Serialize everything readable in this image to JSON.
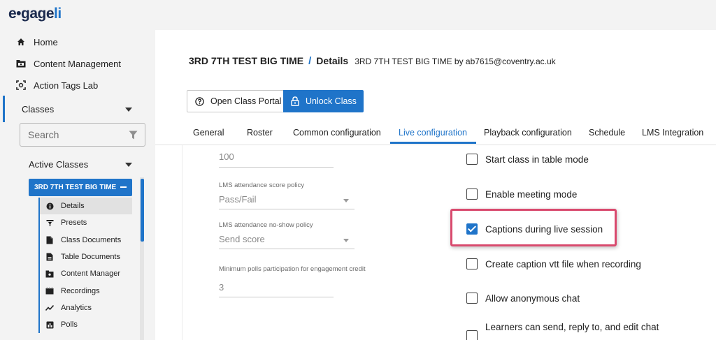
{
  "app": {
    "logo_text_main": "e•gage",
    "logo_text_accent": "li"
  },
  "sidebar": {
    "nav": [
      {
        "label": "Home",
        "icon": "home-icon"
      },
      {
        "label": "Content Management",
        "icon": "folder-icon"
      },
      {
        "label": "Action Tags Lab",
        "icon": "scan-icon"
      }
    ],
    "classes_label": "Classes",
    "search_placeholder": "Search",
    "active_classes_label": "Active Classes",
    "selected_class": "3RD 7TH TEST BIG TIME",
    "sub_items": [
      {
        "label": "Details",
        "icon": "info-icon",
        "active": true
      },
      {
        "label": "Presets",
        "icon": "presets-icon",
        "active": false
      },
      {
        "label": "Class Documents",
        "icon": "document-icon",
        "active": false
      },
      {
        "label": "Table Documents",
        "icon": "table-document-icon",
        "active": false
      },
      {
        "label": "Content Manager",
        "icon": "folder-icon",
        "active": false
      },
      {
        "label": "Recordings",
        "icon": "recordings-icon",
        "active": false
      },
      {
        "label": "Analytics",
        "icon": "analytics-icon",
        "active": false
      },
      {
        "label": "Polls",
        "icon": "polls-icon",
        "active": false
      }
    ]
  },
  "header": {
    "class_name": "3RD 7TH TEST BIG TIME",
    "separator": "/",
    "page_title": "Details",
    "owner_text": "3RD 7TH TEST BIG TIME by ab7615@coventry.ac.uk"
  },
  "actions": {
    "open_portal_label": "Open Class Portal",
    "unlock_label": "Unlock Class"
  },
  "tabs": [
    {
      "label": "General",
      "active": false
    },
    {
      "label": "Roster",
      "active": false
    },
    {
      "label": "Common configuration",
      "active": false
    },
    {
      "label": "Live configuration",
      "active": true
    },
    {
      "label": "Playback configuration",
      "active": false
    },
    {
      "label": "Schedule",
      "active": false
    },
    {
      "label": "LMS Integration",
      "active": false
    }
  ],
  "fields": {
    "top_value": "100",
    "attendance_policy": {
      "label": "LMS attendance score policy",
      "value": "Pass/Fail"
    },
    "no_show_policy": {
      "label": "LMS attendance no-show policy",
      "value": "Send score"
    },
    "min_polls": {
      "label": "Minimum polls participation for engagement credit",
      "value": "3"
    }
  },
  "checkboxes": [
    {
      "label": "Start class in table mode",
      "checked": false
    },
    {
      "label": "Enable meeting mode",
      "checked": false
    },
    {
      "label": "Captions during live session",
      "checked": true
    },
    {
      "label": "Create caption vtt file when recording",
      "checked": false
    },
    {
      "label": "Allow anonymous chat",
      "checked": false
    },
    {
      "label": "Learners can send, reply to, and edit chat",
      "checked": false
    }
  ],
  "colors": {
    "accent": "#1f74c9",
    "highlight": "#d94a6e"
  }
}
